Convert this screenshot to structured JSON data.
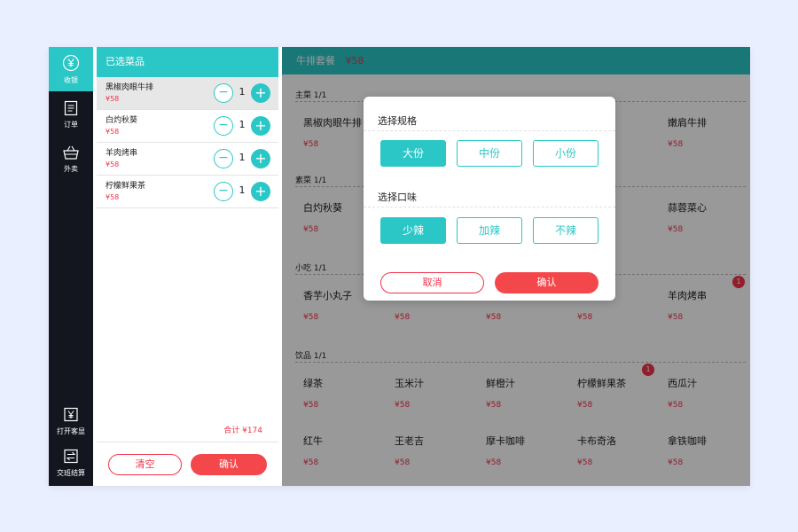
{
  "nav": {
    "items": [
      {
        "label": "收银",
        "icon": "yen-circle-icon"
      },
      {
        "label": "订单",
        "icon": "list-icon"
      },
      {
        "label": "外卖",
        "icon": "basket-icon"
      },
      {
        "label": "打开客显",
        "icon": "yen-display-icon"
      },
      {
        "label": "交班结算",
        "icon": "swap-icon"
      }
    ]
  },
  "order": {
    "title": "已选菜品",
    "items": [
      {
        "name": "黑椒肉眼牛排",
        "price": "¥58",
        "qty": "1"
      },
      {
        "name": "白灼秋葵",
        "price": "¥58",
        "qty": "1"
      },
      {
        "name": "羊肉烤串",
        "price": "¥58",
        "qty": "1"
      },
      {
        "name": "柠檬鲜果茶",
        "price": "¥58",
        "qty": "1"
      }
    ],
    "total": "合计 ¥174",
    "clear_label": "清空",
    "confirm_label": "确认"
  },
  "menu": {
    "header_title": "牛排套餐",
    "header_price": "¥58",
    "categories": [
      {
        "label": "主菜  1/1",
        "items": [
          {
            "name": "黑椒肉眼牛排",
            "price": "¥58"
          },
          {
            "name": "",
            "price": ""
          },
          {
            "name": "",
            "price": ""
          },
          {
            "name": "",
            "price": ""
          },
          {
            "name": "嫩肩牛排",
            "price": "¥58"
          }
        ]
      },
      {
        "label": "素菜  1/1",
        "items": [
          {
            "name": "白灼秋葵",
            "price": "¥58"
          },
          {
            "name": "",
            "price": ""
          },
          {
            "name": "",
            "price": ""
          },
          {
            "name": "",
            "price": ""
          },
          {
            "name": "蒜蓉菜心",
            "price": "¥58"
          }
        ]
      },
      {
        "label": "小吃  1/1",
        "items": [
          {
            "name": "香芋小丸子",
            "price": "¥58"
          },
          {
            "name": "",
            "price": "¥58"
          },
          {
            "name": "",
            "price": "¥58"
          },
          {
            "name": "",
            "price": "¥58"
          },
          {
            "name": "羊肉烤串",
            "price": "¥58",
            "badge": "1"
          }
        ]
      },
      {
        "label": "饮品  1/1",
        "items": [
          {
            "name": "绿茶",
            "price": "¥58"
          },
          {
            "name": "玉米汁",
            "price": "¥58"
          },
          {
            "name": "鲜橙汁",
            "price": "¥58"
          },
          {
            "name": "柠檬鲜果茶",
            "price": "¥58",
            "badge": "1"
          },
          {
            "name": "西瓜汁",
            "price": "¥58"
          },
          {
            "name": "红牛",
            "price": "¥58"
          },
          {
            "name": "王老吉",
            "price": "¥58"
          },
          {
            "name": "摩卡咖啡",
            "price": "¥58"
          },
          {
            "name": "卡布奇洛",
            "price": "¥58"
          },
          {
            "name": "拿铁咖啡",
            "price": "¥58"
          }
        ]
      }
    ]
  },
  "modal": {
    "spec_title": "选择规格",
    "spec_options": [
      "大份",
      "中份",
      "小份"
    ],
    "spec_selected": "大份",
    "taste_title": "选择口味",
    "taste_options": [
      "少辣",
      "加辣",
      "不辣"
    ],
    "taste_selected": "少辣",
    "cancel_label": "取消",
    "confirm_label": "确认"
  },
  "colors": {
    "accent": "#2ac7c6",
    "danger": "#f4324a",
    "nav_bg": "#13161f"
  }
}
